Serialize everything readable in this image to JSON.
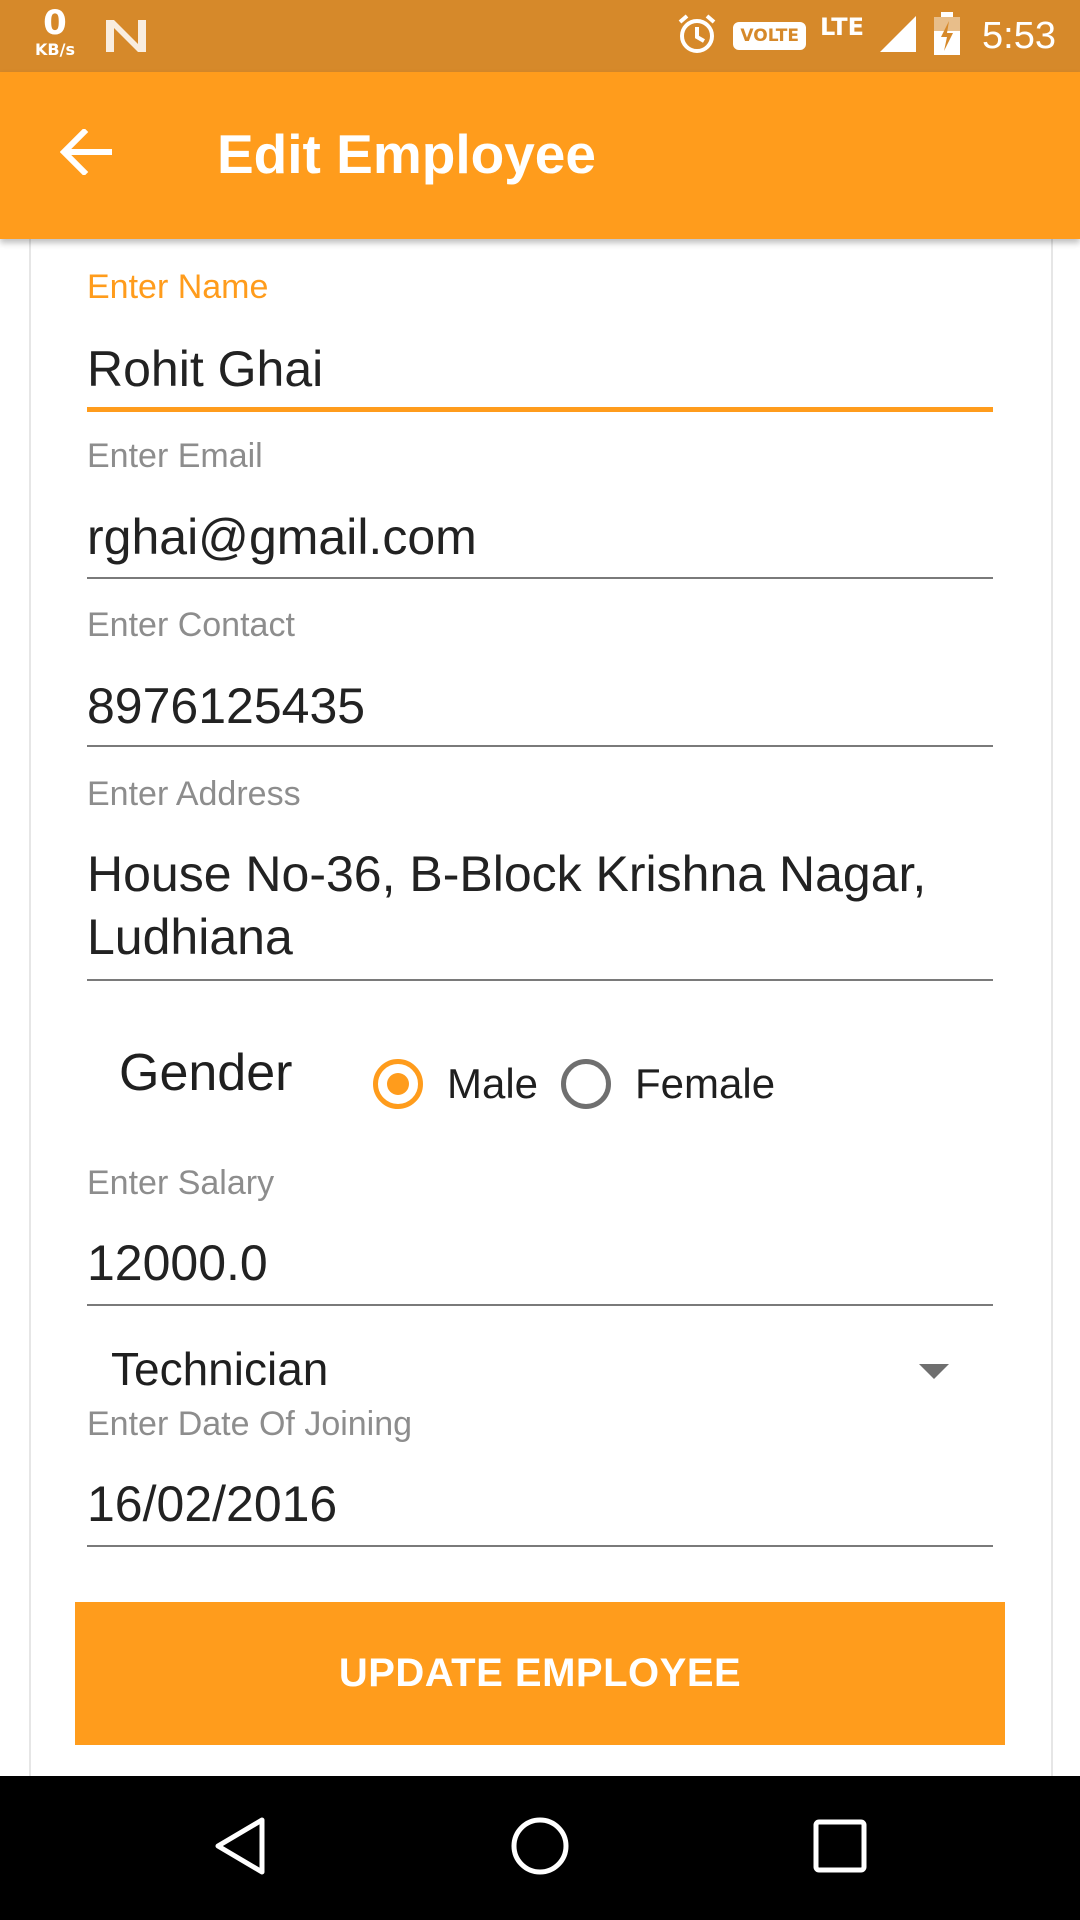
{
  "status_bar": {
    "net_speed_value": "0",
    "net_speed_unit": "KB/s",
    "volte": "VOLTE",
    "network": "LTE",
    "time": "5:53"
  },
  "app_bar": {
    "title": "Edit Employee",
    "back_icon": "arrow-back-icon"
  },
  "form": {
    "name": {
      "label": "Enter Name",
      "value": "Rohit Ghai"
    },
    "email": {
      "label": "Enter Email",
      "value": "rghai@gmail.com"
    },
    "contact": {
      "label": "Enter Contact",
      "value": "8976125435"
    },
    "address": {
      "label": "Enter Address",
      "value_line1": "House No-36, B-Block Krishna Nagar,",
      "value_line2": "Ludhiana"
    },
    "gender": {
      "label": "Gender",
      "options": [
        "Male",
        "Female"
      ],
      "selected": "Male"
    },
    "salary": {
      "label": "Enter Salary",
      "value": "12000.0"
    },
    "designation": {
      "selected": "Technician"
    },
    "joining_date": {
      "label": "Enter Date Of Joining",
      "value": "16/02/2016"
    },
    "submit_label": "UPDATE EMPLOYEE"
  },
  "colors": {
    "accent": "#ff9c1c",
    "status_bar": "#d6892a"
  }
}
